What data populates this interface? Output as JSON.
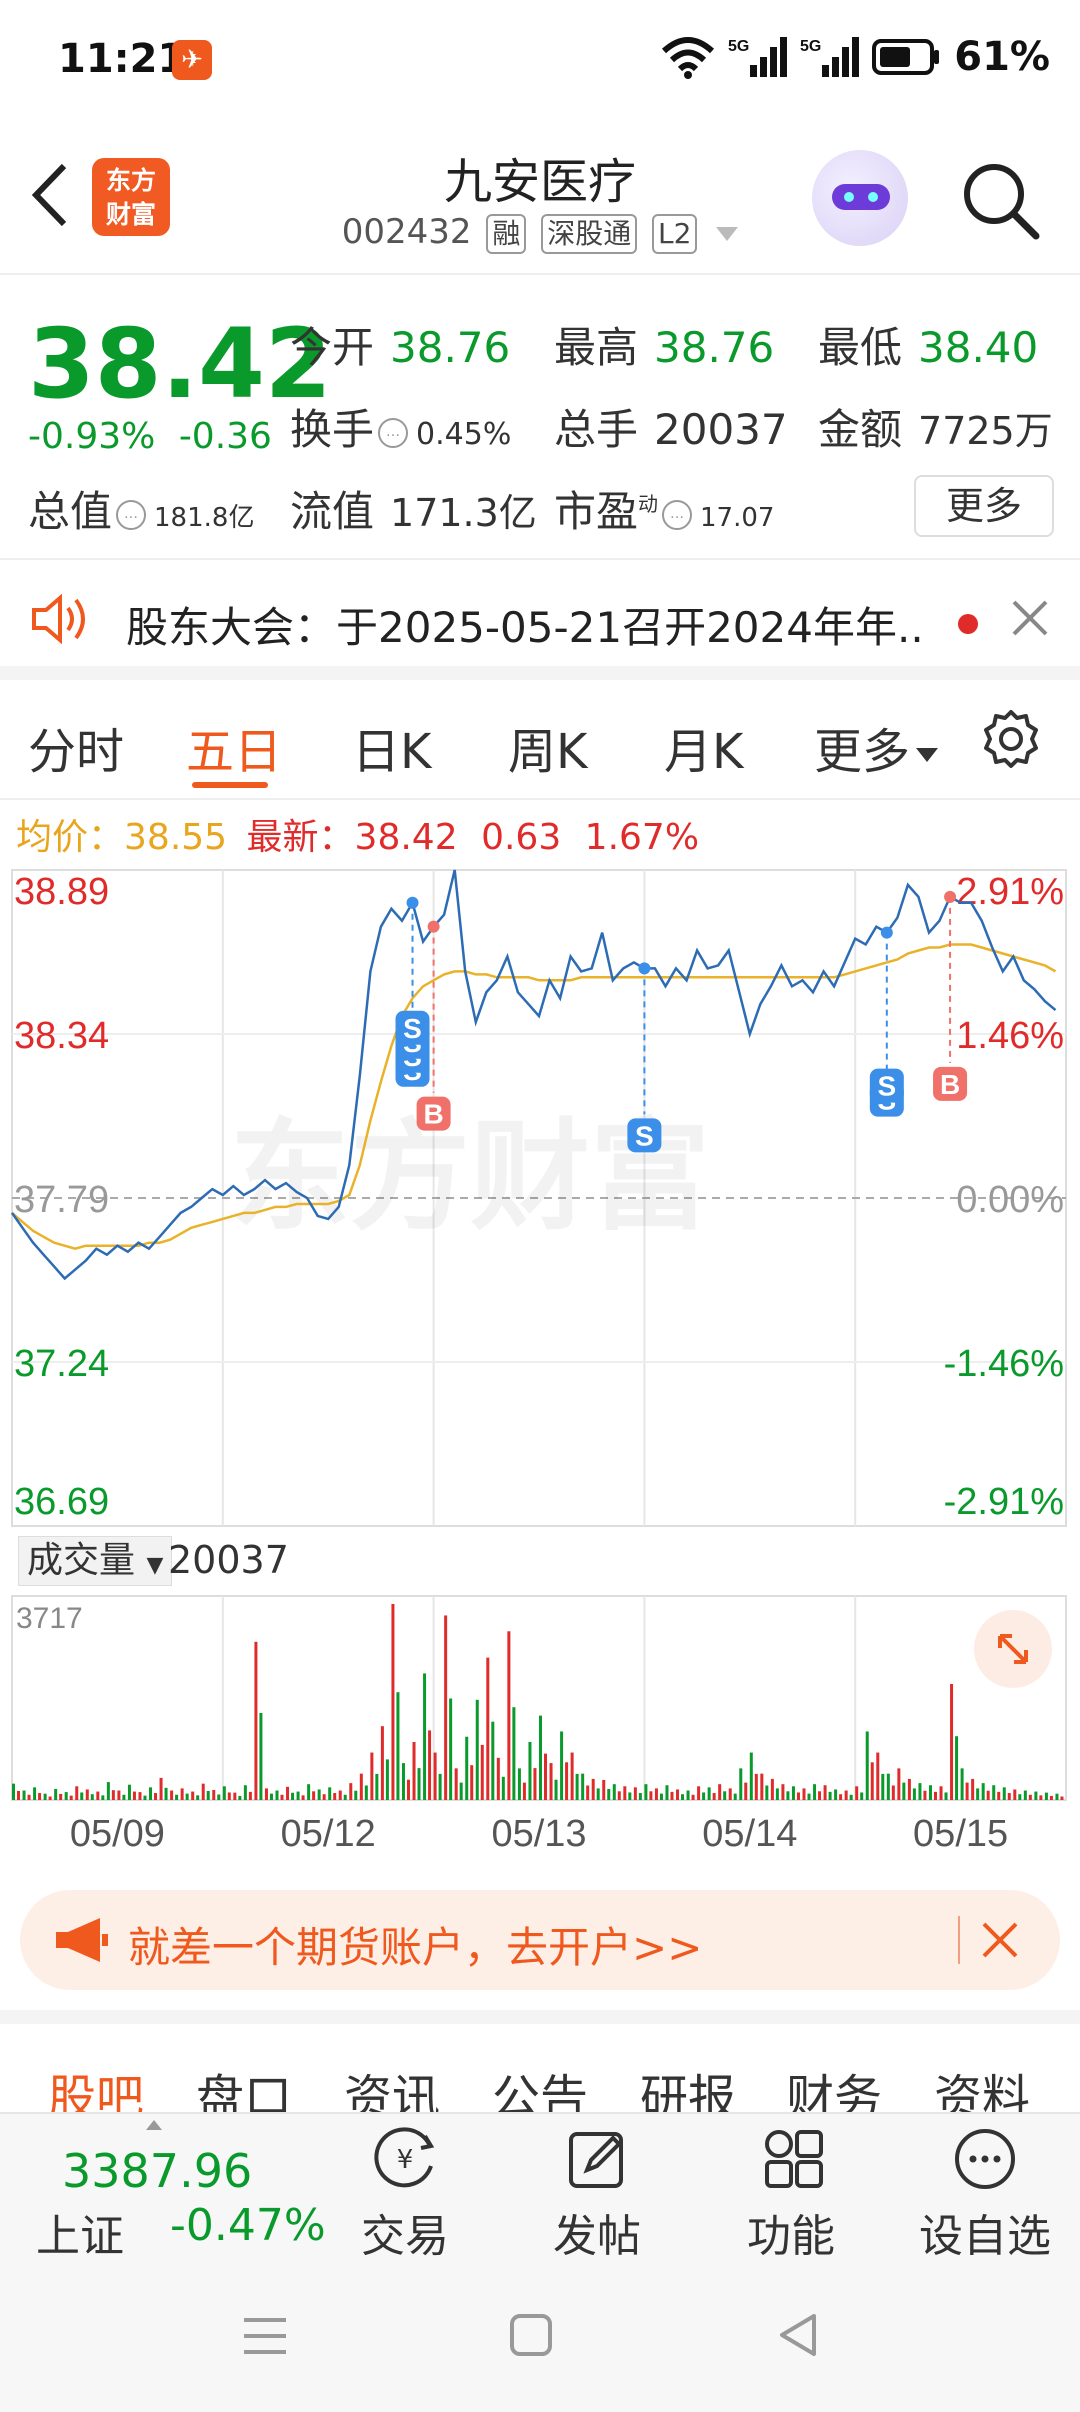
{
  "status": {
    "time": "11:21",
    "battery": "61%",
    "signal1": "5G",
    "signal2": "5G"
  },
  "header": {
    "name": "九安医疗",
    "code": "002432",
    "tag_rong": "融",
    "tag_sgt": "深股通",
    "tag_l2": "L2",
    "logo_line1": "东方",
    "logo_line2": "财富"
  },
  "quote": {
    "price": "38.42",
    "change_pct": "-0.93%",
    "change": "-0.36",
    "fields": {
      "open_label": "今开",
      "open": "38.76",
      "high_label": "最高",
      "high": "38.76",
      "low_label": "最低",
      "low": "38.40",
      "turnover_label": "换手",
      "turnover": "0.45%",
      "volume_label": "总手",
      "volume": "20037",
      "amount_label": "金额",
      "amount": "7725万",
      "mcap_label": "总值",
      "mcap": "181.8亿",
      "float_label": "流值",
      "float": "171.3亿",
      "pe_label": "市盈",
      "pe_sup": "动",
      "pe": "17.07"
    },
    "more": "更多"
  },
  "notice": {
    "text": "股东大会：于2025-05-21召开2024年年..."
  },
  "tabs": [
    "分时",
    "五日",
    "日K",
    "周K",
    "月K",
    "更多"
  ],
  "active_tab": "五日",
  "avg": {
    "avg_label": "均价：",
    "avg": "38.55",
    "latest_label": "最新：",
    "latest": "38.42",
    "chg": "0.63",
    "pct": "1.67%"
  },
  "watermark": "东方财富",
  "volume": {
    "selector": "成交量",
    "value": "20037",
    "max_label": "3717"
  },
  "chart_data": {
    "type": "line",
    "title": "",
    "y_ticks_left": [
      "38.89",
      "38.34",
      "37.79",
      "37.24",
      "36.69"
    ],
    "y_ticks_right": [
      "2.91%",
      "1.46%",
      "0.00%",
      "-1.46%",
      "-2.91%"
    ],
    "ylim": [
      36.69,
      38.89
    ],
    "baseline": 37.79,
    "x_labels": [
      "05/09",
      "05/12",
      "05/13",
      "05/14",
      "05/15"
    ],
    "series": [
      {
        "values": [
          37.74,
          37.69,
          37.64,
          37.6,
          37.56,
          37.52,
          37.55,
          37.58,
          37.62,
          37.6,
          37.63,
          37.61,
          37.64,
          37.62,
          37.66,
          37.7,
          37.74,
          37.76,
          37.79,
          37.82,
          37.8,
          37.83,
          37.8,
          37.82,
          37.85,
          37.82,
          37.84,
          37.81,
          37.79,
          37.73,
          37.72,
          37.76,
          37.9,
          38.2,
          38.55,
          38.7,
          38.76,
          38.72,
          38.78,
          38.65,
          38.7,
          38.74,
          38.89,
          38.55,
          38.38,
          38.48,
          38.52,
          38.6,
          38.48,
          38.44,
          38.4,
          38.52,
          38.46,
          38.6,
          38.55,
          38.56,
          38.68,
          38.52,
          38.56,
          38.58,
          38.56,
          38.56,
          38.5,
          38.56,
          38.52,
          38.62,
          38.56,
          38.57,
          38.62,
          38.48,
          38.34,
          38.44,
          38.5,
          38.57,
          38.5,
          38.52,
          38.48,
          38.55,
          38.5,
          38.58,
          38.66,
          38.64,
          38.7,
          38.68,
          38.73,
          38.84,
          38.8,
          38.68,
          38.72,
          38.8,
          38.78,
          38.78,
          38.72,
          38.63,
          38.55,
          38.6,
          38.52,
          38.49,
          38.45,
          38.42
        ]
      },
      {
        "values": [
          37.74,
          37.71,
          37.68,
          37.66,
          37.64,
          37.63,
          37.62,
          37.63,
          37.63,
          37.63,
          37.63,
          37.63,
          37.63,
          37.64,
          37.64,
          37.65,
          37.67,
          37.69,
          37.7,
          37.71,
          37.72,
          37.73,
          37.74,
          37.74,
          37.75,
          37.76,
          37.76,
          37.77,
          37.77,
          37.77,
          37.77,
          37.78,
          37.8,
          37.9,
          38.05,
          38.18,
          38.3,
          38.4,
          38.46,
          38.5,
          38.52,
          38.54,
          38.55,
          38.55,
          38.54,
          38.54,
          38.53,
          38.53,
          38.53,
          38.53,
          38.52,
          38.52,
          38.52,
          38.52,
          38.53,
          38.53,
          38.53,
          38.53,
          38.53,
          38.53,
          38.53,
          38.53,
          38.53,
          38.53,
          38.53,
          38.53,
          38.53,
          38.53,
          38.53,
          38.53,
          38.53,
          38.53,
          38.53,
          38.53,
          38.53,
          38.53,
          38.53,
          38.53,
          38.53,
          38.54,
          38.55,
          38.56,
          38.57,
          38.58,
          38.59,
          38.61,
          38.62,
          38.63,
          38.63,
          38.64,
          38.64,
          38.64,
          38.63,
          38.62,
          38.61,
          38.6,
          38.59,
          38.58,
          38.57,
          38.55
        ]
      }
    ],
    "markers": [
      {
        "label": "S",
        "i": 38,
        "count": 4,
        "color": "#3b8fe8"
      },
      {
        "label": "B",
        "i": 40,
        "count": 1,
        "color": "#f0706a"
      },
      {
        "label": "S",
        "i": 60,
        "count": 1,
        "color": "#3b8fe8"
      },
      {
        "label": "S",
        "i": 83,
        "count": 2,
        "color": "#3b8fe8"
      },
      {
        "label": "B",
        "i": 89,
        "count": 1,
        "color": "#f0706a"
      }
    ],
    "volume_bars": [
      310,
      180,
      240,
      120,
      210,
      150,
      260,
      200,
      160,
      340,
      180,
      290,
      150,
      240,
      420,
      180,
      220,
      160,
      310,
      190,
      260,
      140,
      280,
      3000,
      220,
      180,
      250,
      160,
      300,
      200,
      240,
      180,
      320,
      500,
      900,
      1400,
      3717,
      700,
      1100,
      2400,
      900,
      3500,
      600,
      1200,
      1900,
      2700,
      800,
      3200,
      600,
      1100,
      1600,
      700,
      1300,
      900,
      500,
      400,
      380,
      300,
      260,
      240,
      300,
      220,
      280,
      200,
      180,
      260,
      240,
      300,
      220,
      600,
      900,
      500,
      400,
      300,
      260,
      220,
      300,
      280,
      200,
      180,
      260,
      1300,
      900,
      500,
      600,
      400,
      320,
      280,
      260,
      2200,
      600,
      400,
      320,
      280,
      240,
      200,
      180,
      160,
      140,
      120
    ]
  },
  "promo": {
    "text": "就差一个期货账户，去开户>>"
  },
  "subtabs": [
    "股吧",
    "盘口",
    "资讯",
    "公告",
    "研报",
    "财务",
    "资料"
  ],
  "index": {
    "value": "3387.96",
    "name": "上证",
    "change": "-0.47%"
  },
  "nav": [
    "交易",
    "发帖",
    "功能",
    "设自选"
  ]
}
